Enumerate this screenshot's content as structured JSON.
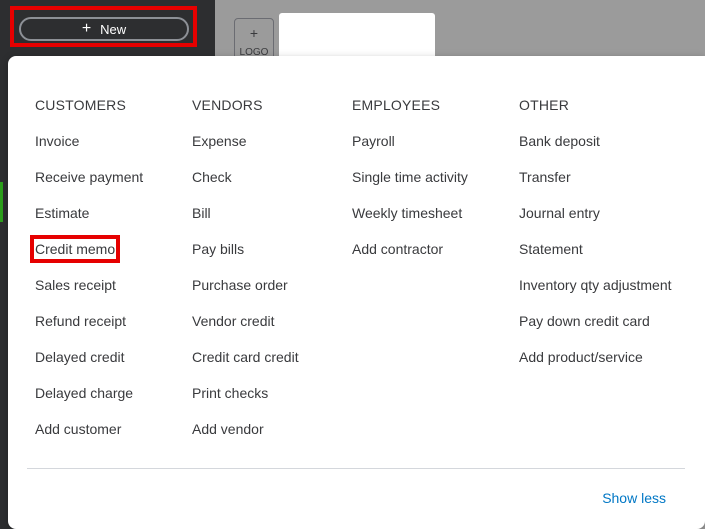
{
  "nav": {
    "new_label": "New",
    "new_plus": "+",
    "logo_plus": "+",
    "logo_text": "LOGO"
  },
  "menu": {
    "columns": [
      {
        "header": "CUSTOMERS",
        "items": [
          "Invoice",
          "Receive payment",
          "Estimate",
          "Credit memo",
          "Sales receipt",
          "Refund receipt",
          "Delayed credit",
          "Delayed charge",
          "Add customer"
        ]
      },
      {
        "header": "VENDORS",
        "items": [
          "Expense",
          "Check",
          "Bill",
          "Pay bills",
          "Purchase order",
          "Vendor credit",
          "Credit card credit",
          "Print checks",
          "Add vendor"
        ]
      },
      {
        "header": "EMPLOYEES",
        "items": [
          "Payroll",
          "Single time activity",
          "Weekly timesheet",
          "Add contractor"
        ]
      },
      {
        "header": "OTHER",
        "items": [
          "Bank deposit",
          "Transfer",
          "Journal entry",
          "Statement",
          "Inventory qty adjustment",
          "Pay down credit card",
          "Add product/service"
        ]
      }
    ],
    "show_less_label": "Show less"
  },
  "colors": {
    "highlight": "#e60000",
    "link": "#0077c5",
    "nav_bg": "#2d2e30",
    "accent": "#2ca01c"
  }
}
